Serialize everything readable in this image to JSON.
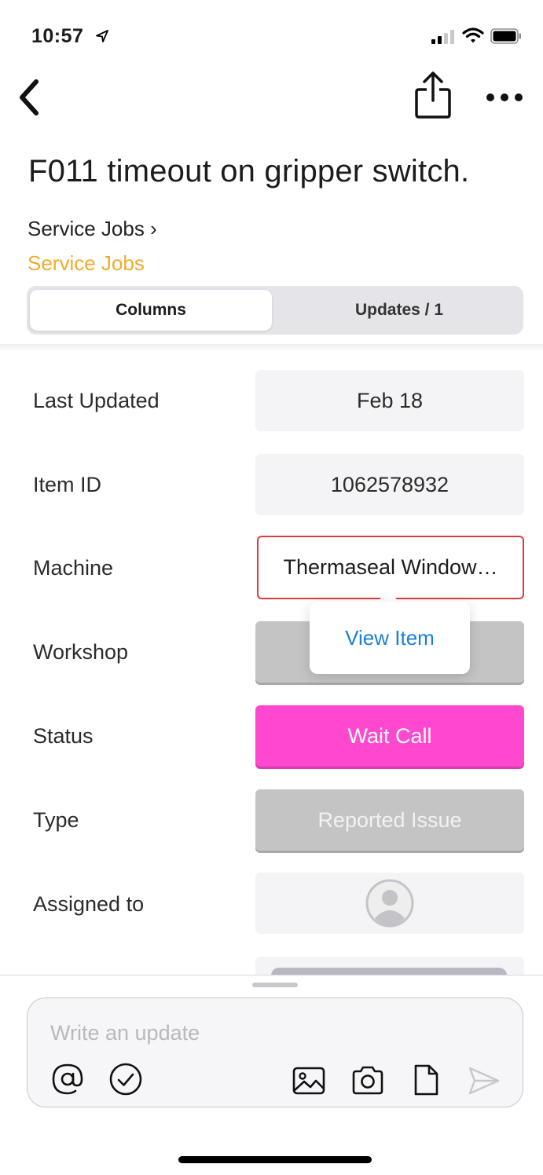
{
  "status_bar": {
    "time": "10:57",
    "icons": [
      "location-arrow-icon",
      "cellular-signal-icon",
      "wifi-icon",
      "battery-icon"
    ]
  },
  "nav": {
    "back_icon": "chevron-left-icon",
    "share_icon": "share-icon",
    "more_icon": "more-horizontal-icon"
  },
  "item": {
    "title": "F011 timeout on gripper switch.",
    "breadcrumb_parent": "Service Jobs ›",
    "breadcrumb_current": "Service Jobs"
  },
  "tabs": [
    {
      "label": "Columns",
      "active": true
    },
    {
      "label": "Updates / 1",
      "active": false
    }
  ],
  "columns": [
    {
      "label": "Last Updated",
      "value": "Feb 18"
    },
    {
      "label": "Item ID",
      "value": "1062578932"
    },
    {
      "label": "Machine",
      "value": "Thermaseal Window…"
    },
    {
      "label": "Workshop",
      "value": ""
    },
    {
      "label": "Status",
      "value": "Wait Call"
    },
    {
      "label": "Type",
      "value": "Reported Issue"
    },
    {
      "label": "Assigned to",
      "value": ""
    }
  ],
  "colors": {
    "status_wait_call": "#ff48cf",
    "type_gray": "#c4c4c4",
    "accent_breadcrumb": "#f0ac2c",
    "link_blue": "#1a7fd4",
    "highlight_border": "#e03a3a"
  },
  "popover": {
    "label": "View Item"
  },
  "composer": {
    "placeholder": "Write an update",
    "tools": [
      "mention-icon",
      "checkmark-circle-icon",
      "image-icon",
      "camera-icon",
      "file-icon",
      "send-icon"
    ]
  }
}
